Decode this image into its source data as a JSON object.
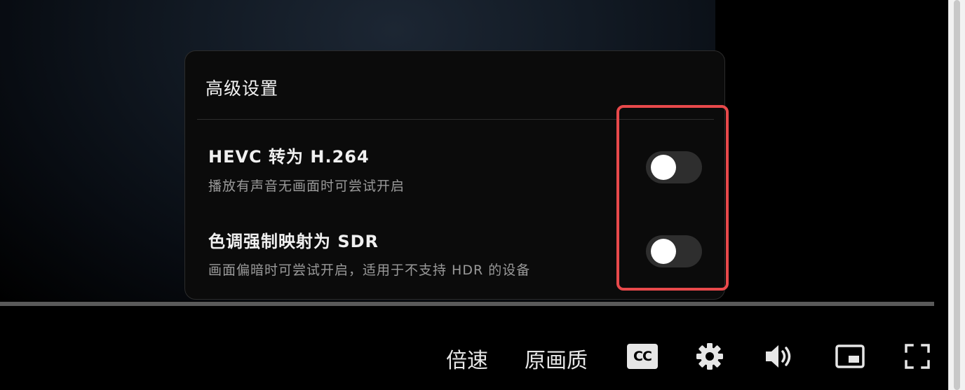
{
  "panel": {
    "title": "高级设置",
    "options": [
      {
        "title": "HEVC 转为 H.264",
        "description": "播放有声音无画面时可尝试开启",
        "enabled": false
      },
      {
        "title": "色调强制映射为 SDR",
        "description": "画面偏暗时可尝试开启，适用于不支持 HDR 的设备",
        "enabled": false
      }
    ]
  },
  "controls": {
    "speed_label": "倍速",
    "quality_label": "原画质",
    "cc_label": "CC",
    "icons": [
      "cc-icon",
      "gear-icon",
      "volume-icon",
      "picture-in-picture-icon",
      "fullscreen-icon"
    ]
  },
  "colors": {
    "highlight": "#e8494b",
    "toggle_off": "#2e2e2e",
    "panel_bg": "#0b0b0b"
  }
}
